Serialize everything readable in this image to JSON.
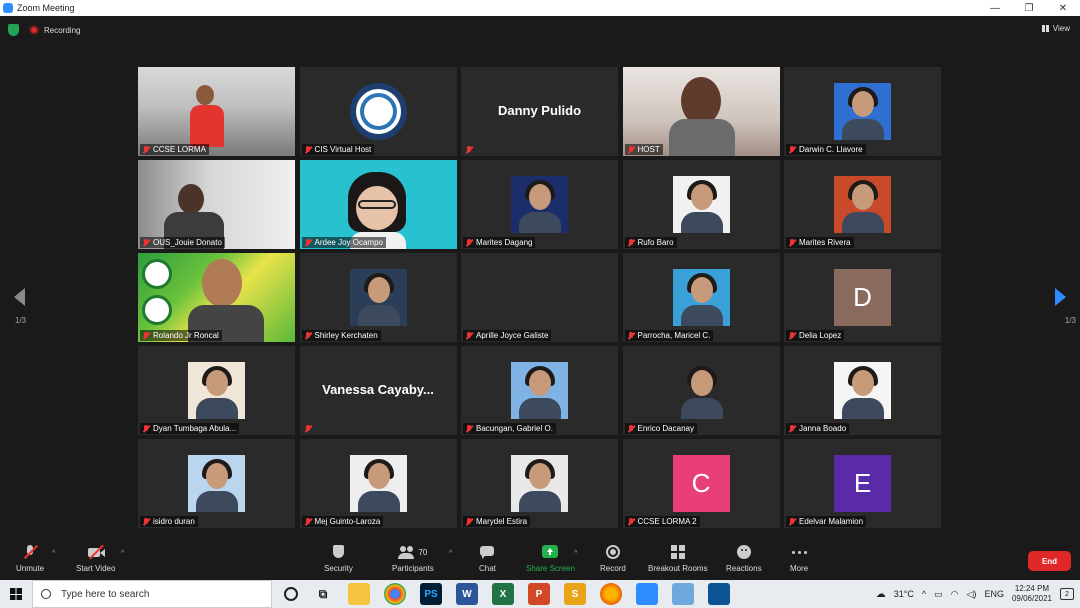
{
  "window": {
    "title": "Zoom Meeting",
    "minimize": "—",
    "maximize": "❐",
    "close": "✕"
  },
  "status": {
    "recording_label": "Recording",
    "view_label": "View"
  },
  "pager": {
    "left": "1/3",
    "right": "1/3"
  },
  "tiles": [
    {
      "name": "CCSE LORMA",
      "kind": "video-room"
    },
    {
      "name": "CIS Virtual Host",
      "kind": "logo"
    },
    {
      "name": "",
      "kind": "bigname",
      "big": "Danny Pulido"
    },
    {
      "name": "HOST",
      "kind": "video-dark"
    },
    {
      "name": "Darwin C. Llavore",
      "kind": "photo",
      "color": "#2f6fd1"
    },
    {
      "name": "OUS_Jouie Donato",
      "kind": "video-grey"
    },
    {
      "name": "Ardee Joy Ocampo",
      "kind": "video-cyan",
      "active": true
    },
    {
      "name": "Marites Dagang",
      "kind": "photo",
      "color": "#1b2d6b"
    },
    {
      "name": "Rufo Baro",
      "kind": "photo",
      "color": "#f1f1f1"
    },
    {
      "name": "Marites Rivera",
      "kind": "photo",
      "color": "#c94a2a"
    },
    {
      "name": "Rolando Jr Roncal",
      "kind": "video-green"
    },
    {
      "name": "Shirley Kerchaten",
      "kind": "photo",
      "color": "#2b3d57"
    },
    {
      "name": "Aprille Joyce Galiste",
      "kind": "blank"
    },
    {
      "name": "Parrocha, Maricel C.",
      "kind": "photo",
      "color": "#3aa0d8"
    },
    {
      "name": "Delia Lopez",
      "kind": "letter",
      "letter": "D",
      "color": "#8b6a5e"
    },
    {
      "name": "Dyan Tumbaga Abula...",
      "kind": "photo",
      "color": "#f0e6d8"
    },
    {
      "name": "",
      "kind": "bigname",
      "big": "Vanessa  Cayaby..."
    },
    {
      "name": "Bacungan, Gabriel O.",
      "kind": "photo",
      "color": "#7fb3e6"
    },
    {
      "name": "Enrico Dacanay",
      "kind": "photo",
      "color": "#2a2a2a"
    },
    {
      "name": "Janna Boado",
      "kind": "photo",
      "color": "#f5f5f5"
    },
    {
      "name": "isidro duran",
      "kind": "photo",
      "color": "#b9d6ee"
    },
    {
      "name": "Mej Guinto-Laroza",
      "kind": "photo",
      "color": "#eeeeee"
    },
    {
      "name": "Marydel Estira",
      "kind": "photo",
      "color": "#e8e8e8"
    },
    {
      "name": "CCSE LORMA 2",
      "kind": "letter",
      "letter": "C",
      "color": "#e83e7a"
    },
    {
      "name": "Edelvar Malamion",
      "kind": "letter",
      "letter": "E",
      "color": "#5b2aa8"
    }
  ],
  "toolbar": {
    "unmute": "Unmute",
    "start_video": "Start Video",
    "security": "Security",
    "participants": "Participants",
    "participants_count": "70",
    "chat": "Chat",
    "share_screen": "Share Screen",
    "record": "Record",
    "breakout_rooms": "Breakout Rooms",
    "reactions": "Reactions",
    "more": "More",
    "end": "End"
  },
  "taskbar": {
    "search_placeholder": "Type here to search",
    "temperature": "31°C",
    "language": "ENG",
    "time": "12:24 PM",
    "date": "09/06/2021",
    "notifications": "2",
    "apps": [
      "PS",
      "W",
      "X",
      "P",
      "S"
    ]
  },
  "colors": {
    "accent": "#2d8cff",
    "end": "#e02828",
    "share": "#23b14d"
  }
}
